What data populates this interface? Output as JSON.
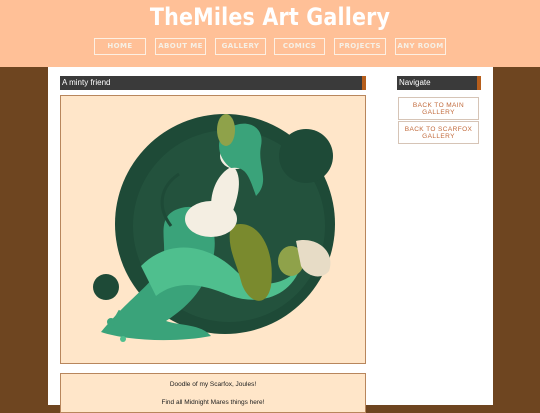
{
  "site": {
    "title": "TheMiles Art Gallery"
  },
  "nav": [
    {
      "label": "HOME"
    },
    {
      "label": "ABOUT ME"
    },
    {
      "label": "GALLERY"
    },
    {
      "label": "COMICS"
    },
    {
      "label": "PROJECTS"
    },
    {
      "label": "ANY ROOM"
    }
  ],
  "post": {
    "title": "A minty friend",
    "description": "Doodle of my Scarfox, Joules!",
    "link_text": "Find all Midnight Mares things here!"
  },
  "sidebar": {
    "heading": "Navigate",
    "buttons": [
      {
        "line1": "BACK TO MAIN",
        "line2": "GALLERY"
      },
      {
        "line1": "BACK TO SCARFOX",
        "line2": "GALLERY"
      }
    ]
  },
  "colors": {
    "header_bg": "#ffc097",
    "page_bg": "#6e4520",
    "bar_bg": "#3a3a3a",
    "bar_accent": "#b65e1c",
    "art_bg": "#ffe6c9",
    "mint": "#3aa37a",
    "dark_green": "#1e4a37",
    "link_text": "#c1693a"
  }
}
